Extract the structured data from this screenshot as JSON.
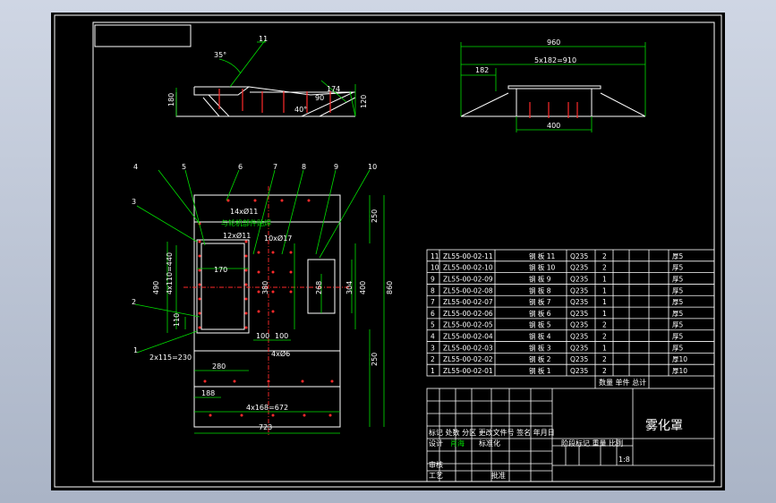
{
  "colors": {
    "bg": "#000000",
    "line": "#ffffff",
    "dim": "#00e000",
    "text": "#ffffff",
    "red": "#ff2a2a",
    "cyan": "#40e0ff",
    "window": "#b6bfd0"
  },
  "top_left": {
    "angle": "35°",
    "part_11": "11",
    "dim_180": "180",
    "dim_174": "174",
    "dim_90": "90",
    "angle_40": "40°",
    "dim_120": "120"
  },
  "top_right": {
    "dim_960": "960",
    "dim_5x182": "5x182=910",
    "dim_182": "182",
    "dim_400": "400"
  },
  "plan": {
    "callouts": [
      "4",
      "5",
      "6",
      "7",
      "8",
      "9",
      "10",
      "3",
      "2",
      "1"
    ],
    "note_holes": "14xØ11",
    "note_weld": "与轮机部件贴焊",
    "note_12": "12xØ11",
    "note_10": "10xØ17",
    "note_4": "4xØ6",
    "dim_490": "490",
    "dim_440": "4x110=440",
    "dim_170": "170",
    "dim_380": "380",
    "dim_268": "268",
    "dim_304": "304",
    "dim_400": "400",
    "dim_110": "110",
    "dim_100a": "100",
    "dim_100b": "100",
    "dim_230": "2x115=230",
    "dim_280": "280",
    "dim_188": "188",
    "dim_672": "4x168=672",
    "dim_723": "723",
    "dim_250a": "250",
    "dim_250b": "250",
    "dim_860": "860"
  },
  "bom": {
    "rows": [
      {
        "no": "11",
        "code": "ZL55-00-02-11",
        "name": "钢 板 11",
        "mat": "Q235",
        "qty": "2",
        "note": "厚5"
      },
      {
        "no": "10",
        "code": "ZL55-00-02-10",
        "name": "钢 板 10",
        "mat": "Q235",
        "qty": "2",
        "note": "厚5"
      },
      {
        "no": "9",
        "code": "ZL55-00-02-09",
        "name": "钢 板 9",
        "mat": "Q235",
        "qty": "1",
        "note": "厚5"
      },
      {
        "no": "8",
        "code": "ZL55-00-02-08",
        "name": "钢 板 8",
        "mat": "Q235",
        "qty": "1",
        "note": "厚5"
      },
      {
        "no": "7",
        "code": "ZL55-00-02-07",
        "name": "钢 板 7",
        "mat": "Q235",
        "qty": "1",
        "note": "厚5"
      },
      {
        "no": "6",
        "code": "ZL55-00-02-06",
        "name": "钢 板 6",
        "mat": "Q235",
        "qty": "1",
        "note": "厚5"
      },
      {
        "no": "5",
        "code": "ZL55-00-02-05",
        "name": "钢 板 5",
        "mat": "Q235",
        "qty": "2",
        "note": "厚5"
      },
      {
        "no": "4",
        "code": "ZL55-00-02-04",
        "name": "钢 板 4",
        "mat": "Q235",
        "qty": "2",
        "note": "厚5"
      },
      {
        "no": "3",
        "code": "ZL55-00-02-03",
        "name": "钢 板 3",
        "mat": "Q235",
        "qty": "1",
        "note": "厚5"
      },
      {
        "no": "2",
        "code": "ZL55-00-02-02",
        "name": "钢 板 2",
        "mat": "Q235",
        "qty": "2",
        "note": "厚10"
      },
      {
        "no": "1",
        "code": "ZL55-00-02-01",
        "name": "钢 板 1",
        "mat": "Q235",
        "qty": "2",
        "note": "厚10"
      }
    ],
    "footer": "数量 单件 总计"
  },
  "title_block": {
    "title": "雾化罩",
    "hdr": "标记 处数 分区 更改文件号 签名 年月日",
    "design": "设计",
    "designer": "肖海",
    "std": "标准化",
    "stage": "阶段标记 重量 比例",
    "scale": "1:8",
    "review": "审核",
    "process": "工艺",
    "approve": "批准"
  }
}
